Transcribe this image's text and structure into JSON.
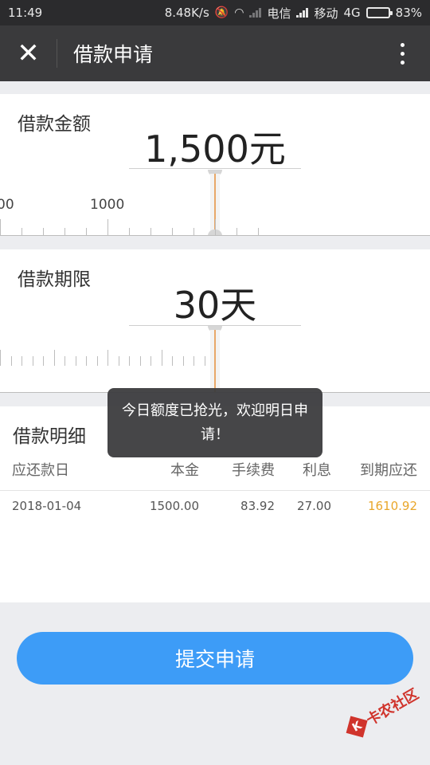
{
  "status_bar": {
    "time": "11:49",
    "speed": "8.48K/s",
    "carrier1": "电信",
    "carrier2": "移动",
    "network": "4G",
    "battery": "83%"
  },
  "app_bar": {
    "title": "借款申请",
    "close_icon": "close-icon",
    "more_icon": "more-vertical-icon"
  },
  "amount": {
    "label": "借款金额",
    "value": "1,500元",
    "ruler_labels": [
      "00",
      "1000"
    ]
  },
  "term": {
    "label": "借款期限",
    "value": "30天"
  },
  "detail": {
    "title": "借款明细",
    "headers": [
      "应还款日",
      "本金",
      "手续费",
      "利息",
      "到期应还"
    ],
    "rows": [
      [
        "2018-01-04",
        "1500.00",
        "83.92",
        "27.00",
        "1610.92"
      ]
    ]
  },
  "toast": {
    "message": "今日额度已抢光，欢迎明日申请！"
  },
  "submit": {
    "label": "提交申请"
  },
  "watermark": {
    "text": "卡农社区"
  },
  "colors": {
    "status_bar": "#2b2b2d",
    "app_bar": "#3a3a3c",
    "accent": "#3d9cf7",
    "due": "#e9a62a",
    "indicator": "#e8a869"
  }
}
